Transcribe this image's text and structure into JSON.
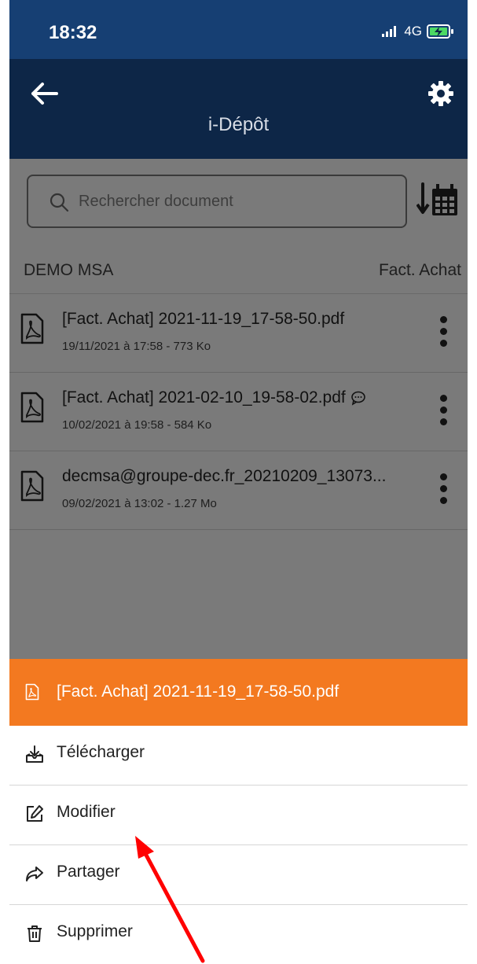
{
  "status_bar": {
    "time": "18:32",
    "network": "4G",
    "signal_icon": "signal-icon",
    "battery_icon": "battery-charging-icon"
  },
  "nav": {
    "title": "i-Dépôt",
    "back_icon": "back-arrow-icon",
    "settings_icon": "gear-icon"
  },
  "search": {
    "placeholder": "Rechercher document",
    "icon": "search-icon",
    "sort_icon": "sort-by-date-icon"
  },
  "folder": {
    "name": "DEMO MSA",
    "category": "Fact. Achat"
  },
  "documents": [
    {
      "title": "[Fact. Achat] 2021-11-19_17-58-50.pdf",
      "meta": "19/11/2021 à 17:58 - 773 Ko",
      "has_comment": false
    },
    {
      "title": "[Fact. Achat] 2021-02-10_19-58-02.pdf",
      "meta": "10/02/2021 à 19:58 - 584 Ko",
      "has_comment": true
    },
    {
      "title": "decmsa@groupe-dec.fr_20210209_13073...",
      "meta": "09/02/2021 à 13:02 - 1.27 Mo",
      "has_comment": false
    }
  ],
  "action_sheet": {
    "title": "[Fact. Achat] 2021-11-19_17-58-50.pdf",
    "header_color": "#f37920",
    "actions": [
      {
        "label": "Télécharger",
        "icon": "download-icon"
      },
      {
        "label": "Modifier",
        "icon": "edit-icon"
      },
      {
        "label": "Partager",
        "icon": "share-icon"
      },
      {
        "label": "Supprimer",
        "icon": "trash-icon"
      }
    ]
  },
  "colors": {
    "status_bar": "#163f73",
    "nav_bar": "#0d2647",
    "overlay": "#7a7a7a",
    "annotation_arrow": "#ff0000"
  }
}
